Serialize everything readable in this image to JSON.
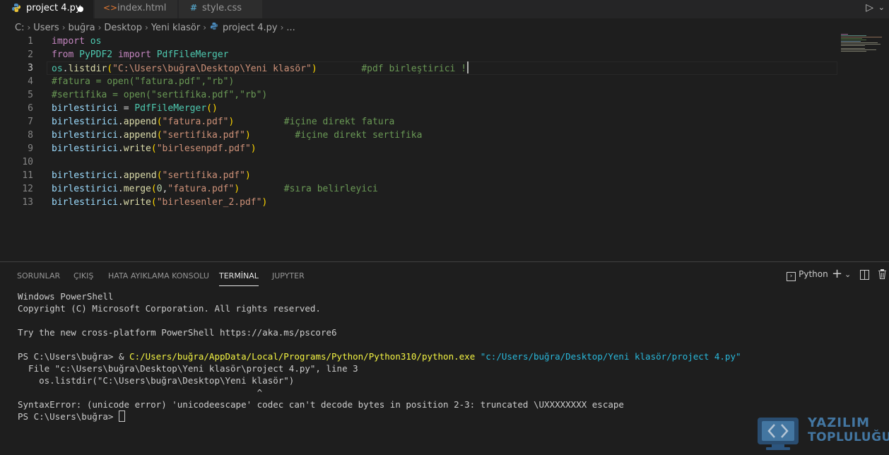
{
  "tabs": [
    {
      "label": "project 4.py",
      "icon": "python-icon",
      "active": true,
      "dirty": true
    },
    {
      "label": "index.html",
      "icon": "html-icon",
      "active": false
    },
    {
      "label": "style.css",
      "icon": "css-icon",
      "active": false
    }
  ],
  "breadcrumb": {
    "parts": [
      "C:",
      "Users",
      "buğra",
      "Desktop",
      "Yeni klasör",
      "project 4.py",
      "..."
    ]
  },
  "editor": {
    "line_numbers": [
      "1",
      "2",
      "3",
      "4",
      "5",
      "6",
      "7",
      "8",
      "9",
      "10",
      "11",
      "12",
      "13"
    ],
    "current_line": 3,
    "code": {
      "l1": {
        "kw": "import",
        "mod": "os"
      },
      "l2": {
        "kw1": "from",
        "mod": "PyPDF2",
        "kw2": "import",
        "cls": "PdfFileMerger"
      },
      "l3": {
        "obj": "os",
        "dot": ".",
        "fn": "listdir",
        "open": "(",
        "str": "\"C:\\Users\\buğra\\Desktop\\Yeni klasör\"",
        "close": ")",
        "comment": "#pdf birleştirici !"
      },
      "l4": {
        "comment": "#fatura = open(\"fatura.pdf\",\"rb\")"
      },
      "l5": {
        "comment": "#sertifika = open(\"sertifika.pdf\",\"rb\")"
      },
      "l6": {
        "var": "birlestirici",
        "eq": " = ",
        "cls": "PdfFileMerger",
        "paren": "()"
      },
      "l7": {
        "var": "birlestirici",
        "dot": ".",
        "fn": "append",
        "open": "(",
        "str": "\"fatura.pdf\"",
        "close": ")",
        "comment": "#içine direkt fatura"
      },
      "l8": {
        "var": "birlestirici",
        "dot": ".",
        "fn": "append",
        "open": "(",
        "str": "\"sertifika.pdf\"",
        "close": ")",
        "comment": "#içine direkt sertifika"
      },
      "l9": {
        "var": "birlestirici",
        "dot": ".",
        "fn": "write",
        "open": "(",
        "str": "\"birlesenpdf.pdf\"",
        "close": ")"
      },
      "l11": {
        "var": "birlestirici",
        "dot": ".",
        "fn": "append",
        "open": "(",
        "str": "\"sertifika.pdf\"",
        "close": ")"
      },
      "l12": {
        "var": "birlestirici",
        "dot": ".",
        "fn": "merge",
        "open": "(",
        "num": "0",
        "comma": ",",
        "str": "\"fatura.pdf\"",
        "close": ")",
        "comment": "#sıra belirleyici"
      },
      "l13": {
        "var": "birlestirici",
        "dot": ".",
        "fn": "write",
        "open": "(",
        "str": "\"birlesenler_2.pdf\"",
        "close": ")"
      }
    }
  },
  "panel": {
    "tabs": [
      "SORUNLAR",
      "ÇIKIŞ",
      "HATA AYIKLAMA KONSOLU",
      "TERMİNAL",
      "JUPYTER"
    ],
    "active_tab": "TERMİNAL",
    "shell_label": "Python",
    "terminal": {
      "line1": "Windows PowerShell",
      "line2": "Copyright (C) Microsoft Corporation. All rights reserved.",
      "line3": "Try the new cross-platform PowerShell https://aka.ms/pscore6",
      "prompt1": "PS C:\\Users\\buğra> & ",
      "exe": "C:/Users/buğra/AppData/Local/Programs/Python/Python310/python.exe",
      "arg": "\"c:/Users/buğra/Desktop/Yeni klasör/project 4.py\"",
      "tb1": "  File \"c:\\Users\\buğra\\Desktop\\Yeni klasör\\project 4.py\", line 3",
      "tb2": "    os.listdir(\"C:\\Users\\buğra\\Desktop\\Yeni klasör\")",
      "tb3": "                                             ^",
      "error": "SyntaxError: (unicode error) 'unicodeescape' codec can't decode bytes in position 2-3: truncated \\UXXXXXXXX escape",
      "prompt2": "PS C:\\Users\\buğra> "
    }
  },
  "watermark": {
    "line1": "YAZILIM",
    "line2": "TOPLULUĞU"
  },
  "colors": {
    "keyword": "#c586c0",
    "variable": "#9cdcfe",
    "class": "#4ec9b0",
    "function": "#dcdcaa",
    "string": "#ce9178",
    "comment": "#6a9955",
    "bracket": "#ffd700"
  }
}
